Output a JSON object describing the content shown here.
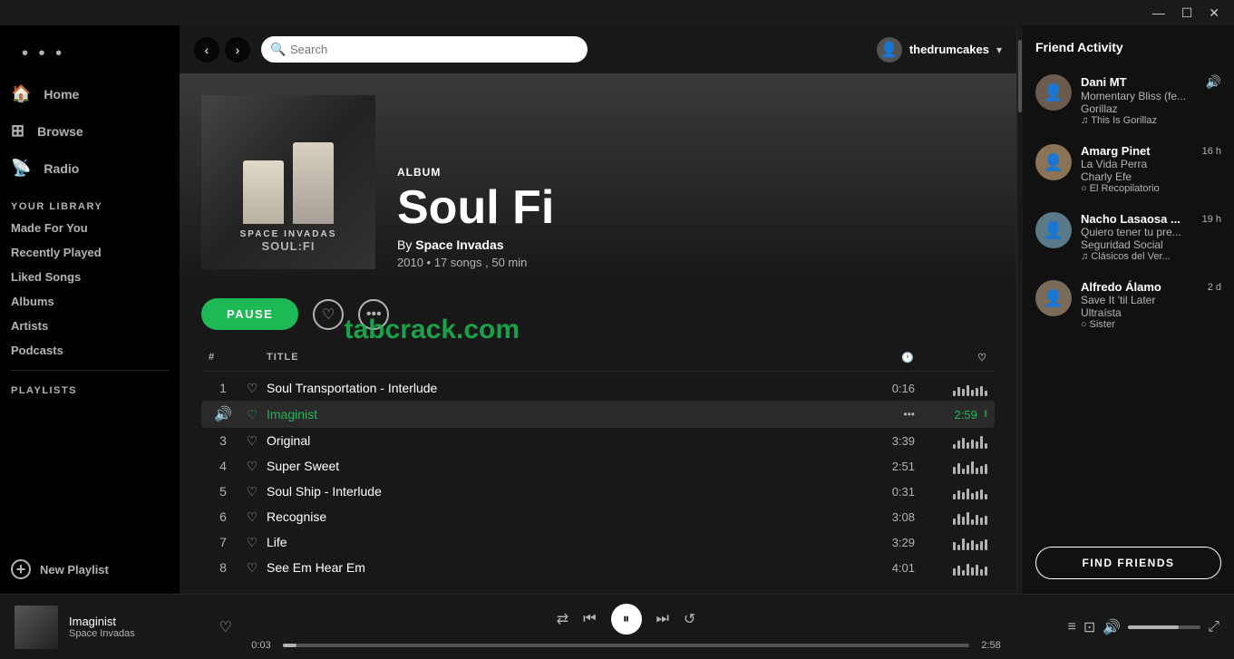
{
  "titlebar": {
    "minimize": "—",
    "maximize": "☐",
    "close": "✕"
  },
  "sidebar": {
    "dots": "• • •",
    "nav": [
      {
        "label": "Home",
        "icon": "🏠"
      },
      {
        "label": "Browse",
        "icon": "⊞"
      },
      {
        "label": "Radio",
        "icon": "📡"
      }
    ],
    "library_label": "YOUR LIBRARY",
    "library_items": [
      {
        "label": "Made For You"
      },
      {
        "label": "Recently Played"
      },
      {
        "label": "Liked Songs"
      },
      {
        "label": "Albums"
      },
      {
        "label": "Artists"
      },
      {
        "label": "Podcasts"
      }
    ],
    "playlists_label": "PLAYLISTS",
    "new_playlist": "New Playlist"
  },
  "topbar": {
    "back": "‹",
    "forward": "›",
    "search_placeholder": "Search",
    "username": "thedrumcakes",
    "dropdown": "▾"
  },
  "album": {
    "type_label": "ALBUM",
    "title": "Soul Fi",
    "artist": "Space Invadas",
    "year": "2010",
    "song_count": "17 songs",
    "duration": "50 min",
    "meta_dot": "•",
    "pause_label": "PAUSE"
  },
  "track_header": {
    "num": "#",
    "title": "TITLE",
    "time_icon": "🕐",
    "like_icon": "♡"
  },
  "tracks": [
    {
      "num": "1",
      "title": "Soul Transportation - Interlude",
      "time": "0:16",
      "playing": false,
      "bars": [
        6,
        10,
        8,
        12,
        7,
        9,
        11,
        6
      ]
    },
    {
      "num": "2",
      "title": "Imaginist",
      "time": "2:59",
      "playing": true,
      "bars": [
        12,
        8,
        15,
        6,
        12
      ]
    },
    {
      "num": "3",
      "title": "Original",
      "time": "3:39",
      "playing": false,
      "bars": [
        5,
        9,
        12,
        7,
        10,
        8,
        14,
        6
      ]
    },
    {
      "num": "4",
      "title": "Super Sweet",
      "time": "2:51",
      "playing": false,
      "bars": [
        8,
        12,
        6,
        10,
        14,
        7,
        9,
        11
      ]
    },
    {
      "num": "5",
      "title": "Soul Ship - Interlude",
      "time": "0:31",
      "playing": false,
      "bars": [
        6,
        10,
        8,
        12,
        7,
        9,
        11,
        6
      ]
    },
    {
      "num": "6",
      "title": "Recognise",
      "time": "3:08",
      "playing": false,
      "bars": [
        7,
        12,
        9,
        14,
        6,
        11,
        8,
        10
      ]
    },
    {
      "num": "7",
      "title": "Life",
      "time": "3:29",
      "playing": false,
      "bars": [
        9,
        6,
        13,
        8,
        11,
        7,
        10,
        12
      ]
    },
    {
      "num": "8",
      "title": "See Em Hear Em",
      "time": "4:01",
      "playing": false,
      "bars": [
        8,
        11,
        6,
        13,
        9,
        12,
        7,
        10
      ]
    }
  ],
  "friends": {
    "panel_title": "Friend Activity",
    "items": [
      {
        "name": "Dani MT",
        "track": "Momentary Bliss (fe...",
        "artist": "Gorillaz",
        "playlist": "This Is Gorillaz",
        "time": "",
        "has_volume": true,
        "avatar_color": "#6b5a4e"
      },
      {
        "name": "Amarg Pinet",
        "track": "La Vida Perra",
        "artist": "Charly Efe",
        "playlist": "El Recopilatorio",
        "time": "16 h",
        "has_volume": false,
        "avatar_color": "#8b7355"
      },
      {
        "name": "Nacho Lasaosa ...",
        "track": "Quiero tener tu pre...",
        "artist": "Seguridad Social",
        "playlist": "Clásicos del Ver...",
        "time": "19 h",
        "has_volume": false,
        "avatar_color": "#5a7a8a"
      },
      {
        "name": "Alfredo Álamo",
        "track": "Save It 'til Later",
        "artist": "Ultraísta",
        "playlist": "Sister",
        "time": "2 d",
        "has_volume": false,
        "avatar_color": "#7a6a5a"
      }
    ],
    "find_friends_label": "FIND FRIENDS"
  },
  "player": {
    "track_name": "Imaginist",
    "artist_name": "Space Invadas",
    "time_current": "0:03",
    "time_total": "2:58",
    "shuffle_icon": "⇄",
    "prev_icon": "⏮",
    "play_icon": "⏸",
    "next_icon": "⏭",
    "repeat_icon": "↺",
    "queue_icon": "≡",
    "devices_icon": "⊡",
    "volume_icon": "🔊",
    "fullscreen_icon": "⤢"
  },
  "watermark": "tabcrack.com"
}
